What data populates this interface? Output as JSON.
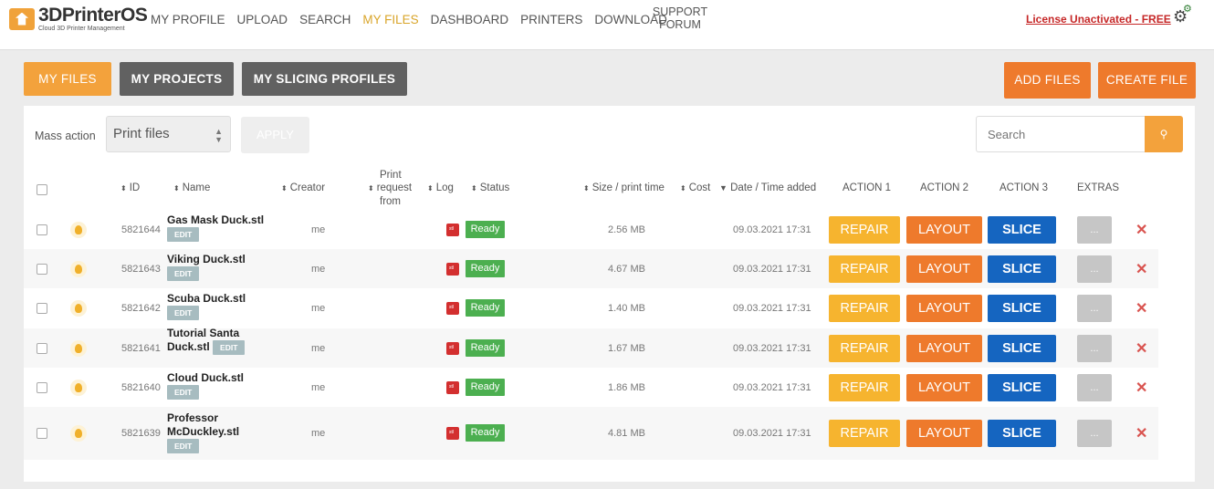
{
  "brand": {
    "title": "3DPrinterOS",
    "subtitle": "Cloud 3D Printer Management"
  },
  "nav": {
    "items": [
      "MY PROFILE",
      "UPLOAD",
      "SEARCH",
      "MY FILES",
      "DASHBOARD",
      "PRINTERS",
      "DOWNLOAD"
    ],
    "active": "MY FILES",
    "support_line1": "SUPPORT",
    "support_line2": "FORUM",
    "license": "License Unactivated - FREE"
  },
  "tabs": {
    "my_files": "MY FILES",
    "my_projects": "MY PROJECTS",
    "my_slicing": "MY SLICING PROFILES"
  },
  "actions": {
    "add_files": "ADD FILES",
    "create_file": "CREATE FILE"
  },
  "toolbar": {
    "mass_action_label": "Mass action",
    "mass_action_value": "Print files",
    "apply_label": "APPLY",
    "search_placeholder": "Search"
  },
  "table": {
    "headers": {
      "id": "ID",
      "name": "Name",
      "creator": "Creator",
      "print_request_1": "Print",
      "print_request_2": "request",
      "print_request_3": "from",
      "log": "Log",
      "status": "Status",
      "size": "Size / print time",
      "cost": "Cost",
      "date": "Date / Time added",
      "action1": "ACTION 1",
      "action2": "ACTION 2",
      "action3": "ACTION 3",
      "extras": "EXTRAS"
    },
    "button_labels": {
      "repair": "REPAIR",
      "layout": "LAYOUT",
      "slice": "SLICE",
      "extras": "...",
      "edit": "EDIT",
      "delete": "✕"
    },
    "rows": [
      {
        "id": "5821644",
        "name1": "Gas Mask Duck.stl",
        "name2": "",
        "creator": "me",
        "status": "Ready",
        "size": "2.56 MB",
        "date": "09.03.2021 17:31"
      },
      {
        "id": "5821643",
        "name1": "Viking Duck.stl",
        "name2": "",
        "creator": "me",
        "status": "Ready",
        "size": "4.67 MB",
        "date": "09.03.2021 17:31"
      },
      {
        "id": "5821642",
        "name1": "Scuba Duck.stl",
        "name2": "",
        "creator": "me",
        "status": "Ready",
        "size": "1.40 MB",
        "date": "09.03.2021 17:31"
      },
      {
        "id": "5821641",
        "name1": "Tutorial Santa",
        "name2": "Duck.stl",
        "creator": "me",
        "status": "Ready",
        "size": "1.67 MB",
        "date": "09.03.2021 17:31"
      },
      {
        "id": "5821640",
        "name1": "Cloud Duck.stl",
        "name2": "",
        "creator": "me",
        "status": "Ready",
        "size": "1.86 MB",
        "date": "09.03.2021 17:31"
      },
      {
        "id": "5821639",
        "name1": "Professor",
        "name2": "McDuckley.stl",
        "creator": "me",
        "status": "Ready",
        "size": "4.81 MB",
        "date": "09.03.2021 17:31"
      }
    ]
  },
  "colors": {
    "orange": "#f3a23c",
    "dark_orange": "#ee7a2c",
    "blue": "#1565c0",
    "green": "#4caf50",
    "red": "#d32f2f"
  }
}
